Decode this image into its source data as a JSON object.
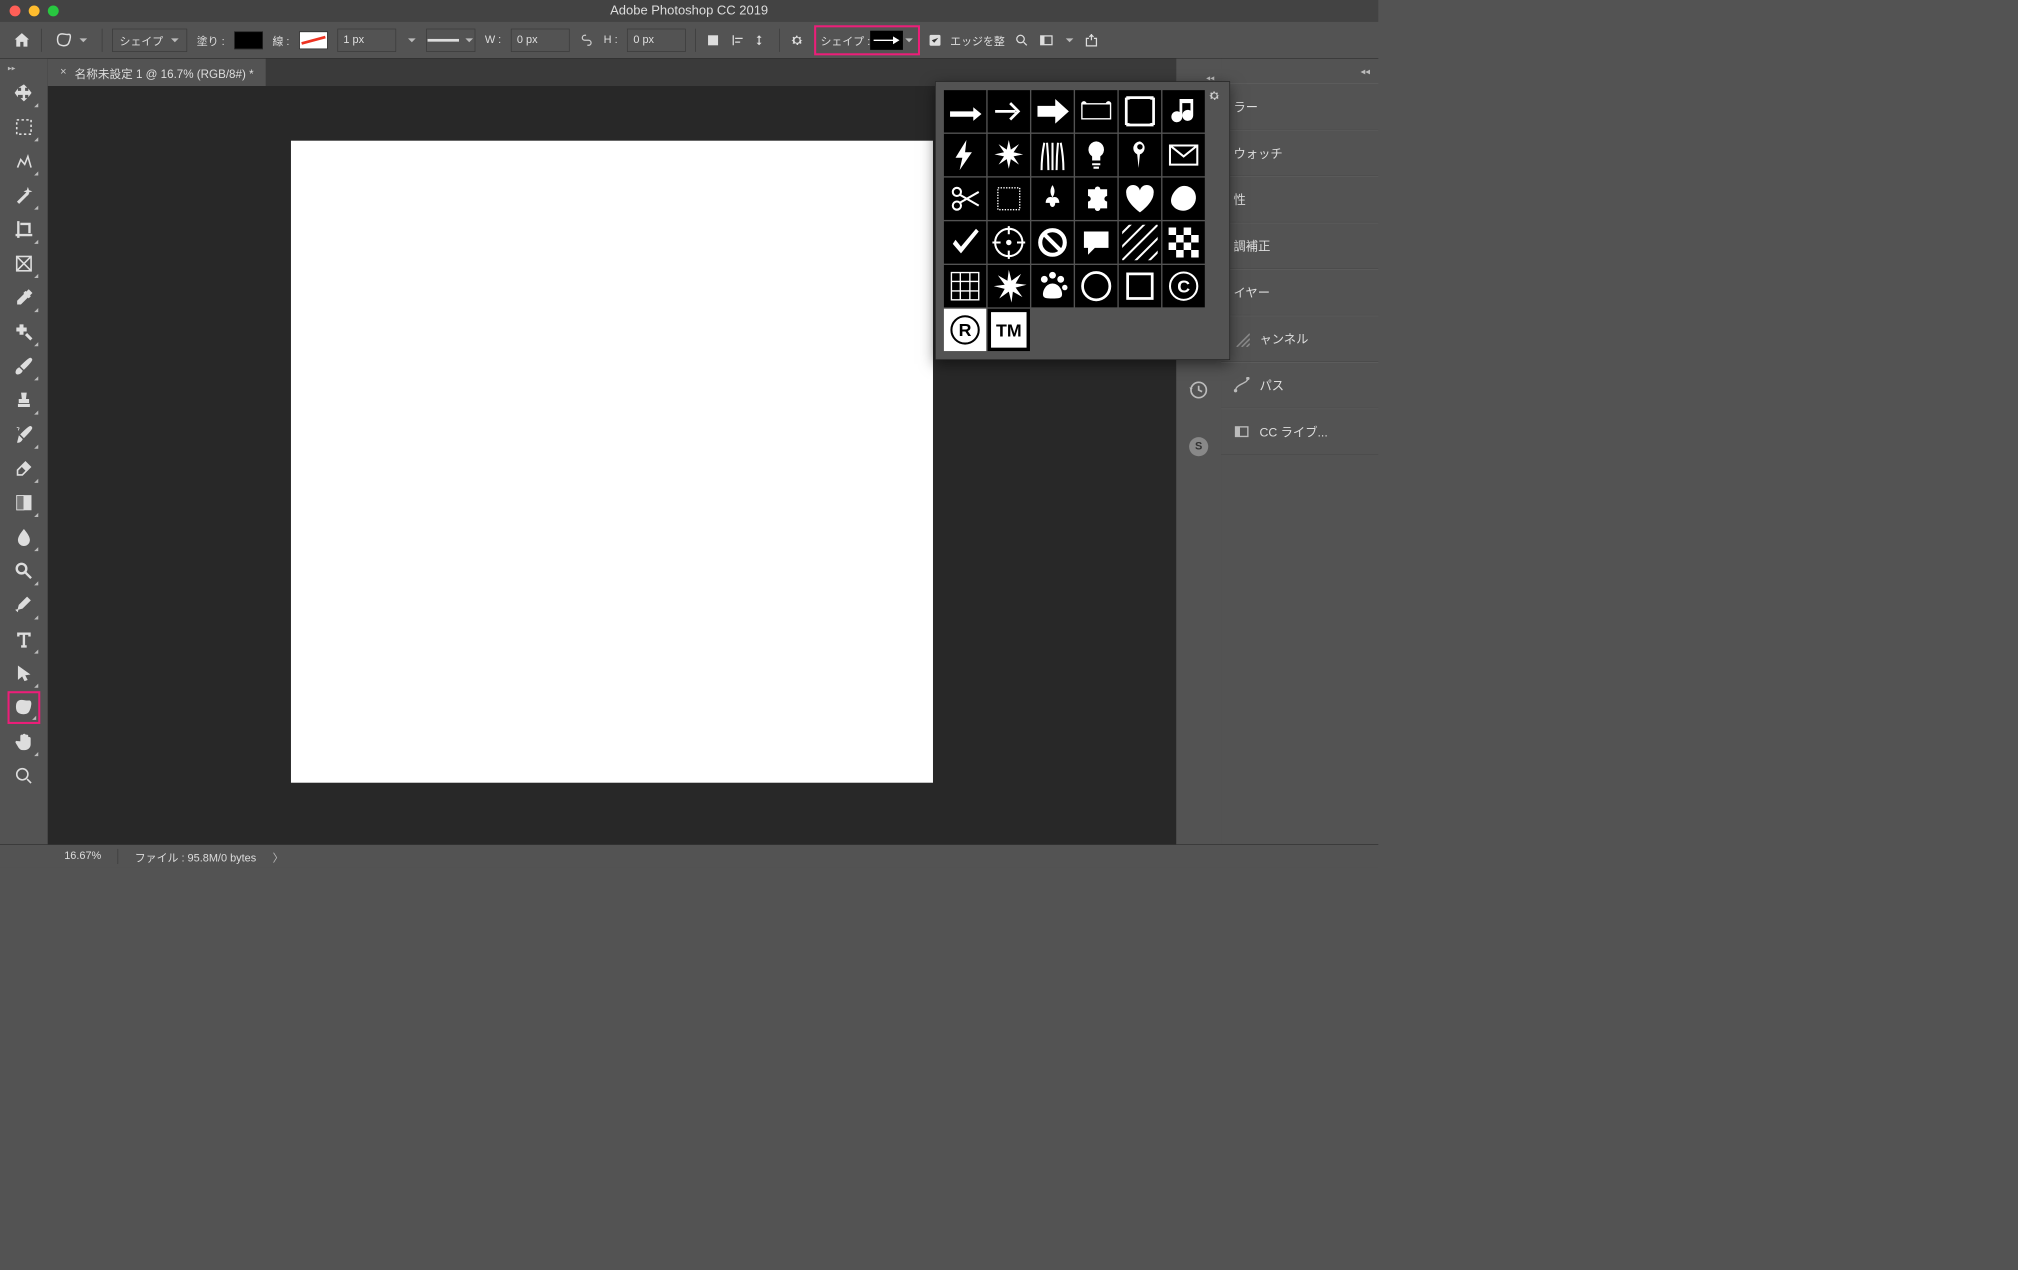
{
  "title": "Adobe Photoshop CC 2019",
  "options": {
    "mode": "シェイプ",
    "fill_label": "塗り :",
    "stroke_label": "線 :",
    "stroke_width": "1 px",
    "w_label": "W :",
    "w_val": "0 px",
    "h_label": "H :",
    "h_val": "0 px",
    "shape_label": "シェイプ :",
    "edge_label": "エッジを整"
  },
  "tab": {
    "title": "名称未設定 1 @ 16.7% (RGB/8#) *"
  },
  "panels": {
    "p1": "ラー",
    "p2": "ウォッチ",
    "p3": "性",
    "p4": "調補正",
    "p5": "イヤー",
    "p6": "ャンネル",
    "p7": "パス",
    "p8": "CC ライブ..."
  },
  "status": {
    "zoom": "16.67%",
    "file": "ファイル : 95.8M/0 bytes"
  },
  "shapes": [
    "arrow-thin",
    "arrow-open",
    "arrow-block",
    "banner",
    "frame",
    "music-note",
    "bolt",
    "burst",
    "grass",
    "bulb",
    "pin",
    "envelope",
    "scissors",
    "stamp",
    "fleur",
    "puzzle",
    "heart",
    "blob",
    "check",
    "target",
    "no",
    "speech",
    "hatch",
    "checker",
    "grid",
    "star-burst",
    "paw",
    "circle-o",
    "square-o",
    "copyright",
    "registered",
    "tm"
  ]
}
